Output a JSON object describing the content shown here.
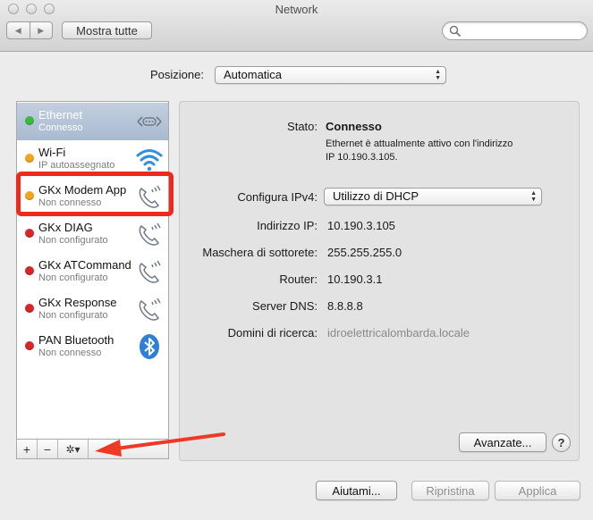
{
  "window": {
    "title": "Network"
  },
  "toolbar": {
    "back": "◀",
    "forward": "▶",
    "show_all": "Mostra tutte",
    "search_placeholder": ""
  },
  "location": {
    "label": "Posizione:",
    "value": "Automatica"
  },
  "services": [
    {
      "name": "Ethernet",
      "status": "Connesso",
      "dot_color": "#3cb93c",
      "icon": "ethernet-icon",
      "selected": true
    },
    {
      "name": "Wi-Fi",
      "status": "IP autoassegnato",
      "dot_color": "#f2a41f",
      "icon": "wifi-icon"
    },
    {
      "name": "GKx Modem App",
      "status": "Non connesso",
      "dot_color": "#f2a41f",
      "icon": "phone-icon"
    },
    {
      "name": "GKx DIAG",
      "status": "Non configurato",
      "dot_color": "#d9252a",
      "icon": "phone-icon"
    },
    {
      "name": "GKx ATCommand",
      "status": "Non configurato",
      "dot_color": "#d9252a",
      "icon": "phone-icon"
    },
    {
      "name": "GKx Response",
      "status": "Non configurato",
      "dot_color": "#d9252a",
      "icon": "phone-icon"
    },
    {
      "name": "PAN Bluetooth",
      "status": "Non connesso",
      "dot_color": "#d9252a",
      "icon": "bluetooth-icon"
    }
  ],
  "sidebar_buttons": {
    "add": "+",
    "remove": "−",
    "action": "✲▾"
  },
  "detail": {
    "status_label": "Stato:",
    "status_value": "Connesso",
    "status_desc_line1": "Ethernet è attualmente attivo con l'indirizzo",
    "status_desc_line2": "IP 10.190.3.105.",
    "ipv4_label": "Configura IPv4:",
    "ipv4_value": "Utilizzo di DHCP",
    "ip_label": "Indirizzo IP:",
    "ip_value": "10.190.3.105",
    "mask_label": "Maschera di sottorete:",
    "mask_value": "255.255.255.0",
    "router_label": "Router:",
    "router_value": "10.190.3.1",
    "dns_label": "Server DNS:",
    "dns_value": "8.8.8.8",
    "search_domains_label": "Domini di ricerca:",
    "search_domains_value": "idroelettricalombarda.locale",
    "advanced_button": "Avanzate...",
    "help_button": "?"
  },
  "footer": {
    "assist": "Aiutami...",
    "revert": "Ripristina",
    "apply": "Applica"
  },
  "colors": {
    "highlight": "#ee2a1c",
    "arrow": "#ee3a24",
    "selected_row": "#a9bad0"
  }
}
